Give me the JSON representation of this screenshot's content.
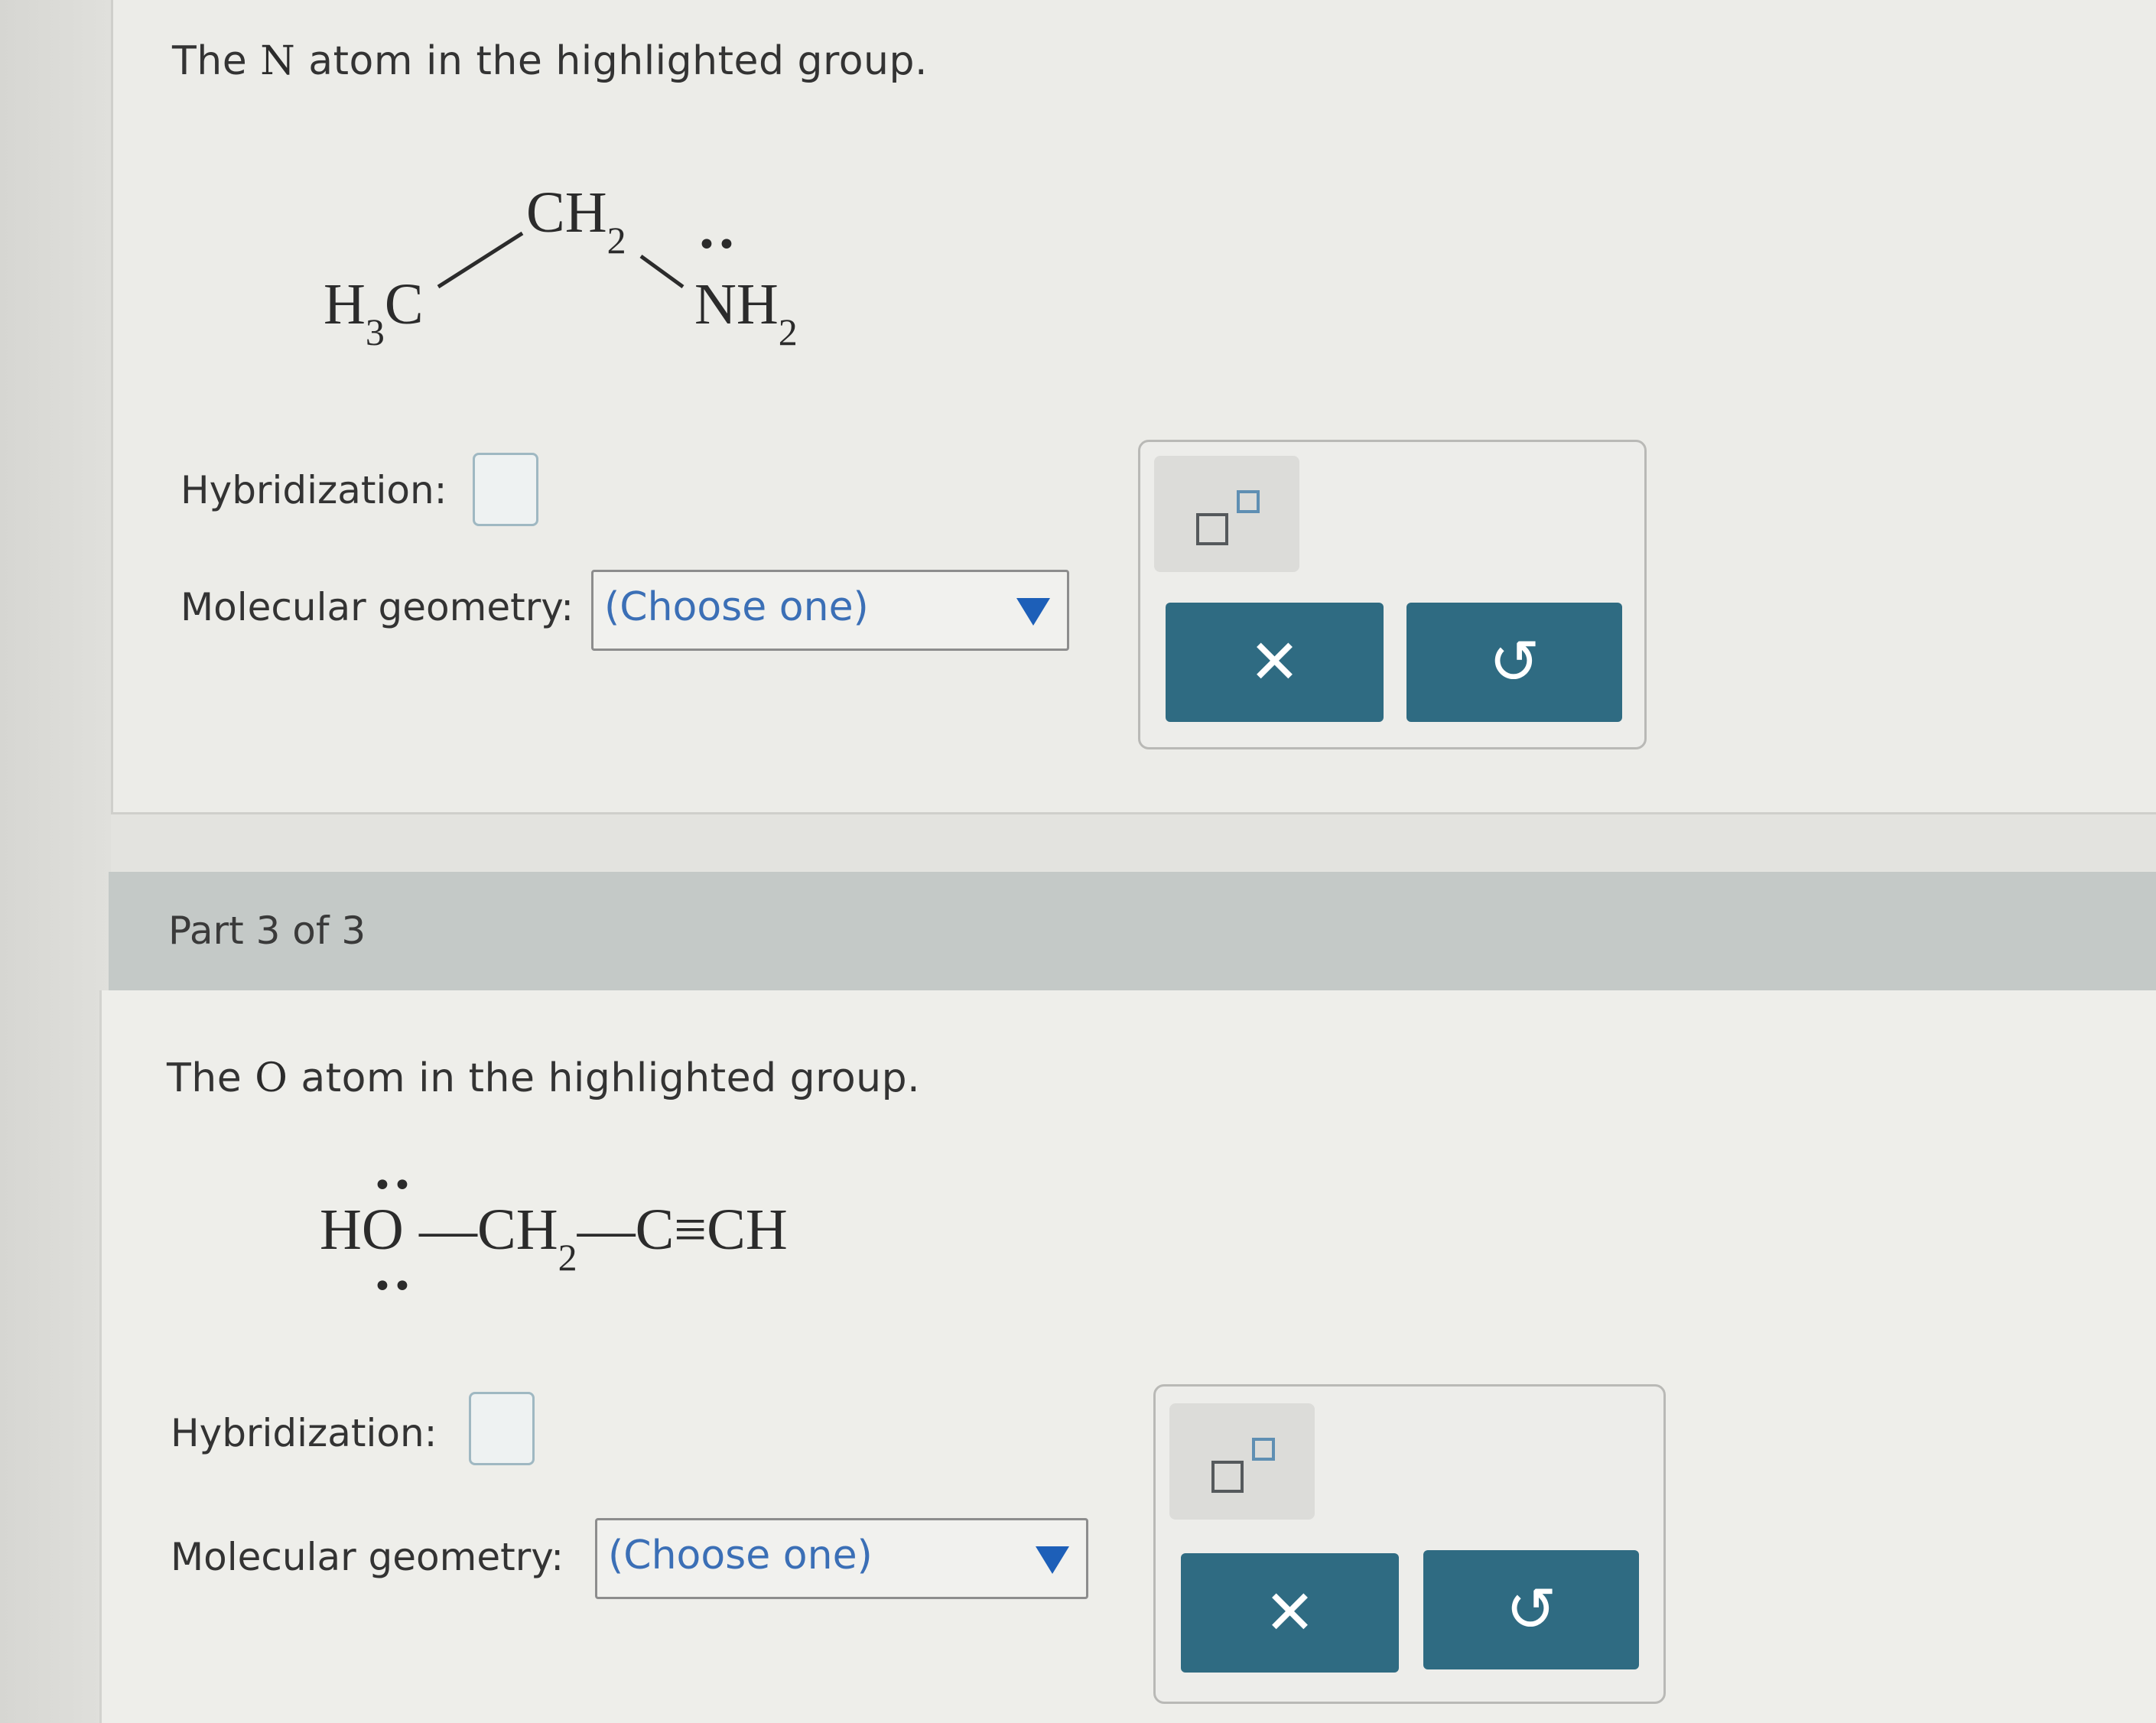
{
  "part2": {
    "prompt_prefix": "The",
    "prompt_atom": "N",
    "prompt_suffix": "atom in the highlighted group.",
    "molecule": {
      "left_group": "H",
      "left_sub": "3",
      "left_c": "C",
      "top_group": "CH",
      "top_sub": "2",
      "right_group": "NH",
      "right_sub": "2",
      "lone_pair": "••"
    },
    "hybridization_label": "Hybridization:",
    "geometry_label": "Molecular geometry:",
    "geometry_select": "(Choose one)",
    "clear_symbol": "✕",
    "undo_symbol": "↺"
  },
  "part3": {
    "header": "Part 3 of 3",
    "prompt_prefix": "The",
    "prompt_atom": "O",
    "prompt_suffix": "atom in the highlighted group.",
    "molecule": {
      "ho": "HO",
      "bond1": "—CH",
      "ch2_sub": "2",
      "bond2": "—C≡CH",
      "lone_pair": "••"
    },
    "hybridization_label": "Hybridization:",
    "geometry_label": "Molecular geometry:",
    "geometry_select": "(Choose one)",
    "clear_symbol": "✕",
    "undo_symbol": "↺"
  },
  "colors": {
    "accent_button": "#2f6b82",
    "highlight_atom": "#c0282c",
    "select_text": "#3b6fb6",
    "part_header_bg": "#c4c9c7"
  }
}
